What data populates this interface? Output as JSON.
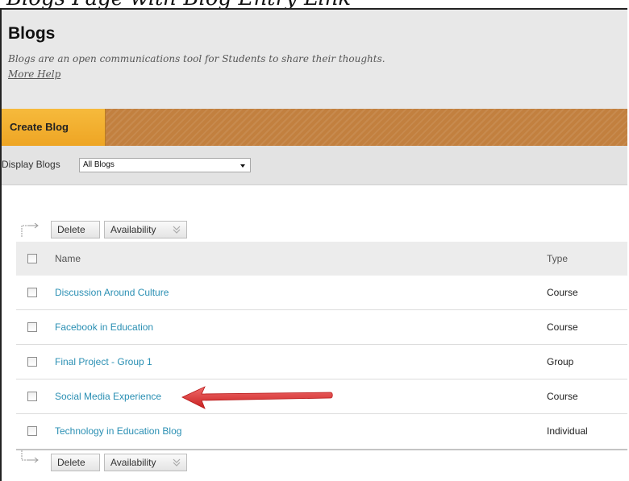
{
  "top_text": "Blogs Page with Blog Entry Link",
  "page": {
    "title": "Blogs",
    "description": "Blogs are an open communications tool for Students to share their thoughts.",
    "help_link": "More Help"
  },
  "actionbar": {
    "create_label": "Create Blog"
  },
  "filter": {
    "label": "Display Blogs",
    "selected": "All Blogs"
  },
  "toolbar": {
    "delete_label": "Delete",
    "availability_label": "Availability"
  },
  "table": {
    "columns": [
      "Name",
      "Type"
    ],
    "rows": [
      {
        "name": "Discussion Around Culture",
        "type": "Course"
      },
      {
        "name": "Facebook in Education",
        "type": "Course"
      },
      {
        "name": "Final Project - Group 1",
        "type": "Group"
      },
      {
        "name": "Social Media Experience",
        "type": "Course"
      },
      {
        "name": "Technology in Education Blog",
        "type": "Individual"
      }
    ]
  },
  "annotation": {
    "arrow_color": "#e03c3c",
    "points_to_row": 3
  },
  "colors": {
    "accent_orange": "#eea524",
    "action_bar": "#c2803f",
    "link": "#2a8fb3"
  }
}
